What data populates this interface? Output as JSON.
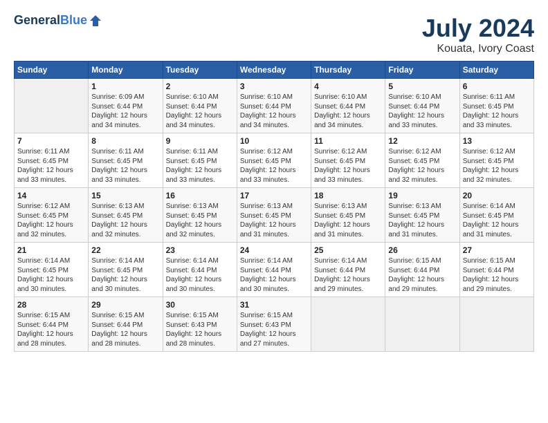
{
  "header": {
    "logo_line1": "General",
    "logo_line2": "Blue",
    "title": "July 2024",
    "subtitle": "Kouata, Ivory Coast"
  },
  "days_of_week": [
    "Sunday",
    "Monday",
    "Tuesday",
    "Wednesday",
    "Thursday",
    "Friday",
    "Saturday"
  ],
  "weeks": [
    [
      {
        "day": "",
        "info": ""
      },
      {
        "day": "1",
        "info": "Sunrise: 6:09 AM\nSunset: 6:44 PM\nDaylight: 12 hours\nand 34 minutes."
      },
      {
        "day": "2",
        "info": "Sunrise: 6:10 AM\nSunset: 6:44 PM\nDaylight: 12 hours\nand 34 minutes."
      },
      {
        "day": "3",
        "info": "Sunrise: 6:10 AM\nSunset: 6:44 PM\nDaylight: 12 hours\nand 34 minutes."
      },
      {
        "day": "4",
        "info": "Sunrise: 6:10 AM\nSunset: 6:44 PM\nDaylight: 12 hours\nand 34 minutes."
      },
      {
        "day": "5",
        "info": "Sunrise: 6:10 AM\nSunset: 6:44 PM\nDaylight: 12 hours\nand 33 minutes."
      },
      {
        "day": "6",
        "info": "Sunrise: 6:11 AM\nSunset: 6:45 PM\nDaylight: 12 hours\nand 33 minutes."
      }
    ],
    [
      {
        "day": "7",
        "info": "Sunrise: 6:11 AM\nSunset: 6:45 PM\nDaylight: 12 hours\nand 33 minutes."
      },
      {
        "day": "8",
        "info": "Sunrise: 6:11 AM\nSunset: 6:45 PM\nDaylight: 12 hours\nand 33 minutes."
      },
      {
        "day": "9",
        "info": "Sunrise: 6:11 AM\nSunset: 6:45 PM\nDaylight: 12 hours\nand 33 minutes."
      },
      {
        "day": "10",
        "info": "Sunrise: 6:12 AM\nSunset: 6:45 PM\nDaylight: 12 hours\nand 33 minutes."
      },
      {
        "day": "11",
        "info": "Sunrise: 6:12 AM\nSunset: 6:45 PM\nDaylight: 12 hours\nand 33 minutes."
      },
      {
        "day": "12",
        "info": "Sunrise: 6:12 AM\nSunset: 6:45 PM\nDaylight: 12 hours\nand 32 minutes."
      },
      {
        "day": "13",
        "info": "Sunrise: 6:12 AM\nSunset: 6:45 PM\nDaylight: 12 hours\nand 32 minutes."
      }
    ],
    [
      {
        "day": "14",
        "info": "Sunrise: 6:12 AM\nSunset: 6:45 PM\nDaylight: 12 hours\nand 32 minutes."
      },
      {
        "day": "15",
        "info": "Sunrise: 6:13 AM\nSunset: 6:45 PM\nDaylight: 12 hours\nand 32 minutes."
      },
      {
        "day": "16",
        "info": "Sunrise: 6:13 AM\nSunset: 6:45 PM\nDaylight: 12 hours\nand 32 minutes."
      },
      {
        "day": "17",
        "info": "Sunrise: 6:13 AM\nSunset: 6:45 PM\nDaylight: 12 hours\nand 31 minutes."
      },
      {
        "day": "18",
        "info": "Sunrise: 6:13 AM\nSunset: 6:45 PM\nDaylight: 12 hours\nand 31 minutes."
      },
      {
        "day": "19",
        "info": "Sunrise: 6:13 AM\nSunset: 6:45 PM\nDaylight: 12 hours\nand 31 minutes."
      },
      {
        "day": "20",
        "info": "Sunrise: 6:14 AM\nSunset: 6:45 PM\nDaylight: 12 hours\nand 31 minutes."
      }
    ],
    [
      {
        "day": "21",
        "info": "Sunrise: 6:14 AM\nSunset: 6:45 PM\nDaylight: 12 hours\nand 30 minutes."
      },
      {
        "day": "22",
        "info": "Sunrise: 6:14 AM\nSunset: 6:45 PM\nDaylight: 12 hours\nand 30 minutes."
      },
      {
        "day": "23",
        "info": "Sunrise: 6:14 AM\nSunset: 6:44 PM\nDaylight: 12 hours\nand 30 minutes."
      },
      {
        "day": "24",
        "info": "Sunrise: 6:14 AM\nSunset: 6:44 PM\nDaylight: 12 hours\nand 30 minutes."
      },
      {
        "day": "25",
        "info": "Sunrise: 6:14 AM\nSunset: 6:44 PM\nDaylight: 12 hours\nand 29 minutes."
      },
      {
        "day": "26",
        "info": "Sunrise: 6:15 AM\nSunset: 6:44 PM\nDaylight: 12 hours\nand 29 minutes."
      },
      {
        "day": "27",
        "info": "Sunrise: 6:15 AM\nSunset: 6:44 PM\nDaylight: 12 hours\nand 29 minutes."
      }
    ],
    [
      {
        "day": "28",
        "info": "Sunrise: 6:15 AM\nSunset: 6:44 PM\nDaylight: 12 hours\nand 28 minutes."
      },
      {
        "day": "29",
        "info": "Sunrise: 6:15 AM\nSunset: 6:44 PM\nDaylight: 12 hours\nand 28 minutes."
      },
      {
        "day": "30",
        "info": "Sunrise: 6:15 AM\nSunset: 6:43 PM\nDaylight: 12 hours\nand 28 minutes."
      },
      {
        "day": "31",
        "info": "Sunrise: 6:15 AM\nSunset: 6:43 PM\nDaylight: 12 hours\nand 27 minutes."
      },
      {
        "day": "",
        "info": ""
      },
      {
        "day": "",
        "info": ""
      },
      {
        "day": "",
        "info": ""
      }
    ]
  ]
}
